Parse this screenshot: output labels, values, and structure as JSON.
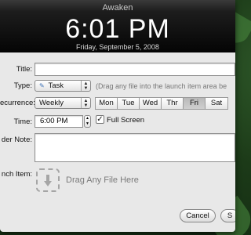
{
  "window": {
    "title": "Awaken",
    "time": "6:01 PM",
    "date": "Friday, September 5, 2008"
  },
  "form": {
    "title_label": "Title:",
    "title_value": "",
    "type_label": "Type:",
    "type_value": "Task",
    "type_hint": "(Drag any file into the launch item area be",
    "recurrence_label": "ecurrence:",
    "recurrence_value": "Weekly",
    "days": [
      "Mon",
      "Tue",
      "Wed",
      "Thr",
      "Fri",
      "Sat"
    ],
    "selected_day": "Fri",
    "time_label": "Time:",
    "time_value": "6:00 PM",
    "fullscreen_label": "Full Screen",
    "fullscreen_checked": true,
    "reminder_label": "der Note:",
    "reminder_value": "",
    "launch_label": "nch Item:",
    "drop_text": "Drag Any File Here"
  },
  "buttons": {
    "cancel": "Cancel",
    "save_partial": "S"
  },
  "icons": {
    "type_icon": "task-icon",
    "drop_icon": "download-arrow-icon"
  }
}
